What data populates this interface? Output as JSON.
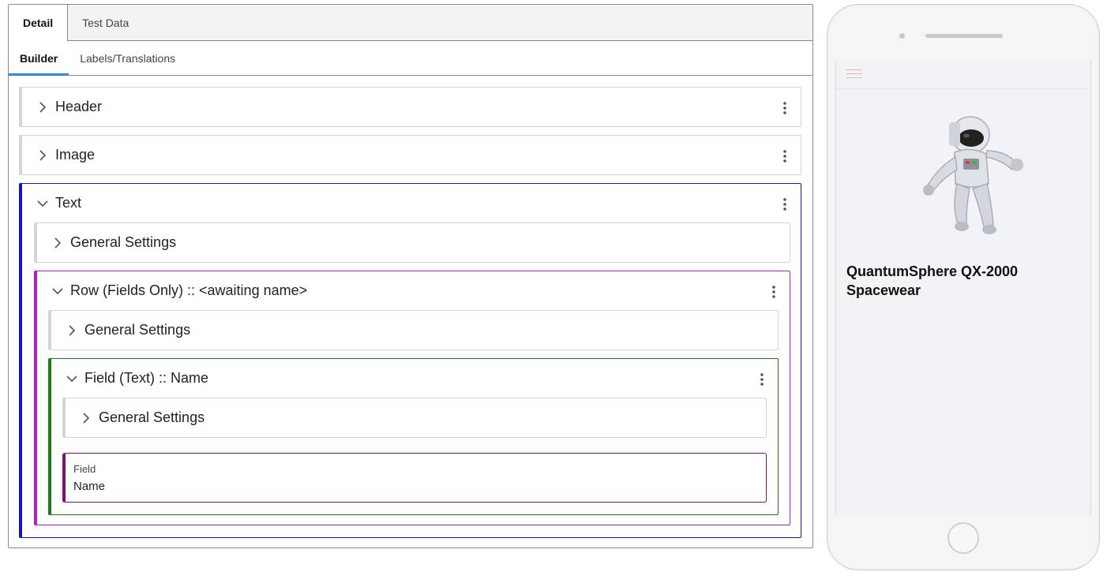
{
  "tabs_top": [
    {
      "label": "Detail",
      "active": true
    },
    {
      "label": "Test Data",
      "active": false
    }
  ],
  "tabs_sub": [
    {
      "label": "Builder",
      "active": true
    },
    {
      "label": "Labels/Translations",
      "active": false
    }
  ],
  "sections": {
    "header": {
      "title": "Header",
      "expanded": false
    },
    "image": {
      "title": "Image",
      "expanded": false
    },
    "text": {
      "title": "Text",
      "expanded": true,
      "general": "General Settings",
      "row": {
        "title": "Row (Fields Only) :: <awaiting name>",
        "expanded": true,
        "general": "General Settings",
        "field": {
          "title": "Field (Text) :: Name",
          "expanded": true,
          "general": "General Settings",
          "preview_label": "Field",
          "preview_value": "Name"
        }
      }
    }
  },
  "colors": {
    "text_section_accent": "#1414c8",
    "row_section_accent": "#b31fc6",
    "field_section_accent": "#1b7a1b",
    "field_box_accent": "#7b0f7b",
    "tab_underline": "#2e8ad8"
  },
  "phone": {
    "product_title": "QuantumSphere QX-2000 Spacewear",
    "menu_icon": "hamburger-icon",
    "image_subject": "astronaut"
  }
}
